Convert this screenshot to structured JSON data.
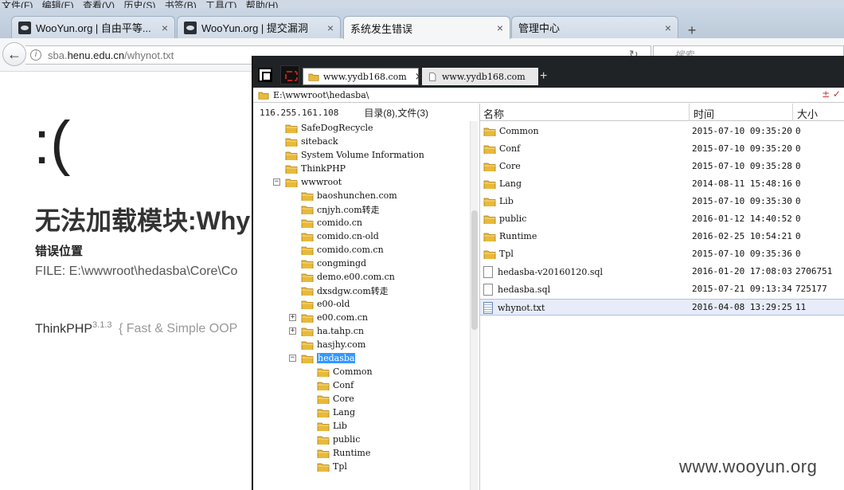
{
  "browser": {
    "menu": [
      "文件(F)",
      "编辑(E)",
      "查看(V)",
      "历史(S)",
      "书签(B)",
      "工具(T)",
      "帮助(H)"
    ],
    "tabs": [
      {
        "label": "WooYun.org | 自由平等...",
        "close": "×"
      },
      {
        "label": "WooYun.org | 提交漏洞",
        "close": "×"
      },
      {
        "label": "系统发生错误",
        "close": "×"
      },
      {
        "label": "管理中心",
        "close": "×"
      }
    ],
    "new_tab": "+",
    "url_prefix": "sba.",
    "url_host": "henu.edu.cn",
    "url_path": "/whynot.txt",
    "search_placeholder": "搜索"
  },
  "page": {
    "sad_face": ":(",
    "error_title": "无法加载模块:Why",
    "error_location_label": "错误位置",
    "error_file": "FILE: E:\\wwwroot\\hedasba\\Core\\Co",
    "framework_name": "ThinkPHP",
    "framework_version": "3.1.3",
    "framework_slogan": "{ Fast & Simple OOP"
  },
  "file_manager": {
    "tabs": [
      {
        "label": "www.yydb168.com",
        "close": "×",
        "icon": "folder-icon"
      },
      {
        "label": "www.yydb168.com",
        "icon": "file-icon"
      }
    ],
    "new_tab": "+",
    "path": "E:\\wwwroot\\hedasba\\",
    "path_controls": "± ✓",
    "server_ip": "116.255.161.108",
    "counts": "目录(8),文件(3)",
    "tree": [
      {
        "label": "SafeDogRecycle"
      },
      {
        "label": "siteback"
      },
      {
        "label": "System Volume Information"
      },
      {
        "label": "ThinkPHP"
      },
      {
        "label": "wwwroot",
        "expander": "−"
      },
      {
        "label": "baoshunchen.com"
      },
      {
        "label": "cnjyh.com转走"
      },
      {
        "label": "comido.cn"
      },
      {
        "label": "comido.cn-old"
      },
      {
        "label": "comido.com.cn"
      },
      {
        "label": "congmingd"
      },
      {
        "label": "demo.e00.com.cn"
      },
      {
        "label": "dxsdgw.com转走"
      },
      {
        "label": "e00-old"
      },
      {
        "label": "e00.com.cn",
        "expander": "+"
      },
      {
        "label": "ha.tahp.cn",
        "expander": "+"
      },
      {
        "label": "hasjhy.com"
      },
      {
        "label": "hedasba",
        "expander": "−",
        "selected": true
      },
      {
        "label": "Common"
      },
      {
        "label": "Conf"
      },
      {
        "label": "Core"
      },
      {
        "label": "Lang"
      },
      {
        "label": "Lib"
      },
      {
        "label": "public"
      },
      {
        "label": "Runtime"
      },
      {
        "label": "Tpl"
      }
    ],
    "columns": {
      "name": "名称",
      "time": "时间",
      "size": "大小"
    },
    "files": [
      {
        "name": "Common",
        "time": "2015-07-10 09:35:20",
        "size": "0",
        "kind": "folder"
      },
      {
        "name": "Conf",
        "time": "2015-07-10 09:35:20",
        "size": "0",
        "kind": "folder"
      },
      {
        "name": "Core",
        "time": "2015-07-10 09:35:28",
        "size": "0",
        "kind": "folder"
      },
      {
        "name": "Lang",
        "time": "2014-08-11 15:48:16",
        "size": "0",
        "kind": "folder"
      },
      {
        "name": "Lib",
        "time": "2015-07-10 09:35:30",
        "size": "0",
        "kind": "folder"
      },
      {
        "name": "public",
        "time": "2016-01-12 14:40:52",
        "size": "0",
        "kind": "folder"
      },
      {
        "name": "Runtime",
        "time": "2016-02-25 10:54:21",
        "size": "0",
        "kind": "folder"
      },
      {
        "name": "Tpl",
        "time": "2015-07-10 09:35:36",
        "size": "0",
        "kind": "folder"
      },
      {
        "name": "hedasba-v20160120.sql",
        "time": "2016-01-20 17:08:03",
        "size": "2706751",
        "kind": "file"
      },
      {
        "name": "hedasba.sql",
        "time": "2015-07-21 09:13:34",
        "size": "725177",
        "kind": "file"
      },
      {
        "name": "whynot.txt",
        "time": "2016-04-08 13:29:25",
        "size": "11",
        "kind": "text",
        "selected": true
      }
    ]
  },
  "watermark": "www.wooyun.org",
  "colors": {
    "folder": "#e8b93a",
    "selection": "#3399ff",
    "row_selected": "#e7ecf8"
  }
}
